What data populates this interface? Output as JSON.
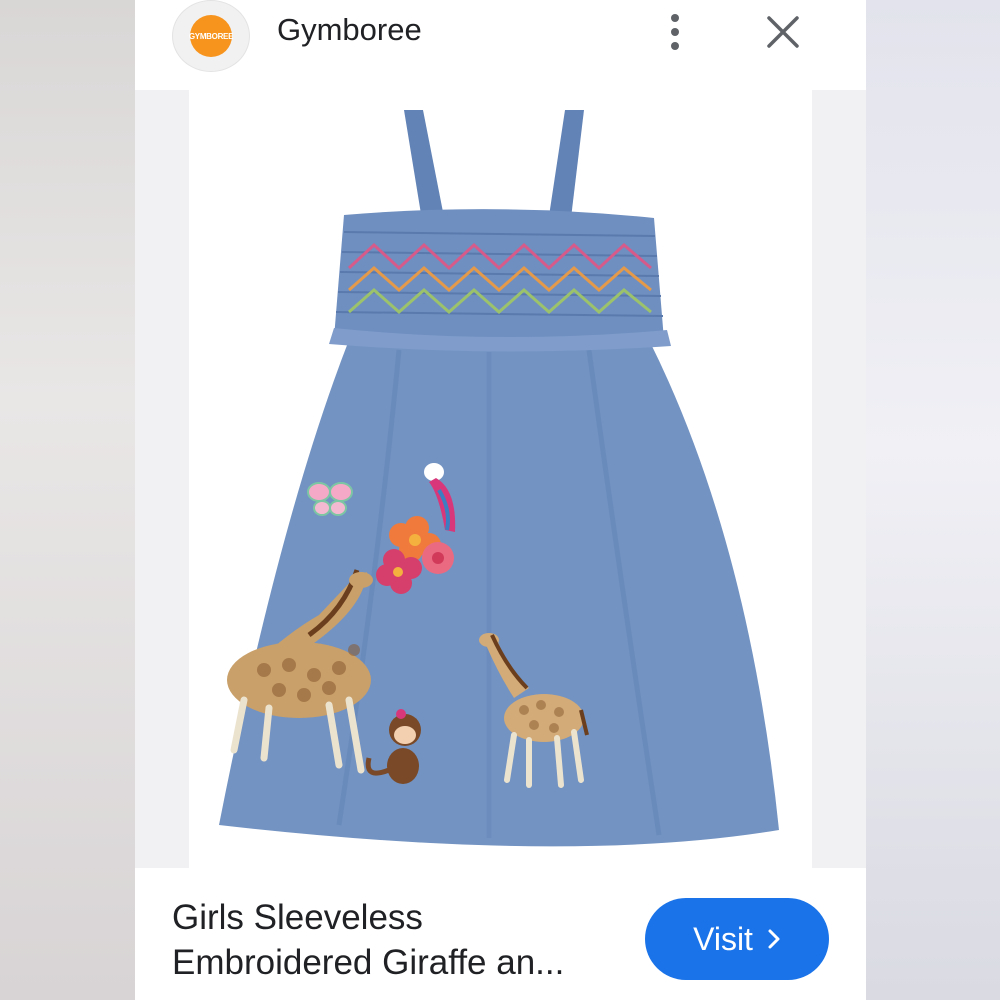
{
  "header": {
    "logo_text": "GYMBOREE",
    "brand": "Gymboree",
    "more_icon": "more-vert-icon",
    "close_icon": "close-icon"
  },
  "product": {
    "image_alt": "Chambray sleeveless dress with smocked bodice and embroidered giraffes, monkey, parrot, flowers and butterfly",
    "title_line1": "Girls Sleeveless",
    "title_line2": "Embroidered Giraffe an..."
  },
  "actions": {
    "visit_label": "Visit",
    "visit_icon": "chevron-right-icon"
  },
  "colors": {
    "accent": "#1a73e8",
    "logo": "#f7941d",
    "denim": "#6e8fbe"
  }
}
